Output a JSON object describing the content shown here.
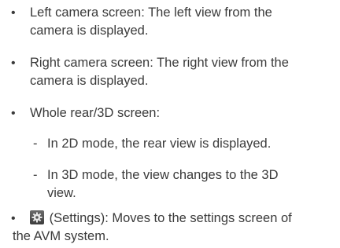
{
  "items": [
    {
      "bullet": "•",
      "line1": "Left camera screen: The left view from the",
      "line2": "camera is displayed."
    },
    {
      "bullet": "•",
      "line1": "Right camera screen: The right view from the",
      "line2": "camera is displayed."
    },
    {
      "bullet": "•",
      "line1": "Whole rear/3D screen:"
    }
  ],
  "sub_items": [
    {
      "dash": "-",
      "line1": "In 2D mode, the rear view is displayed."
    },
    {
      "dash": "-",
      "line1": "In 3D mode, the view changes to the 3D",
      "line2": "view."
    }
  ],
  "settings_item": {
    "bullet": "•",
    "icon": "gear-icon",
    "line1": "(Settings): Moves to the settings screen of",
    "line2": "the AVM system."
  }
}
